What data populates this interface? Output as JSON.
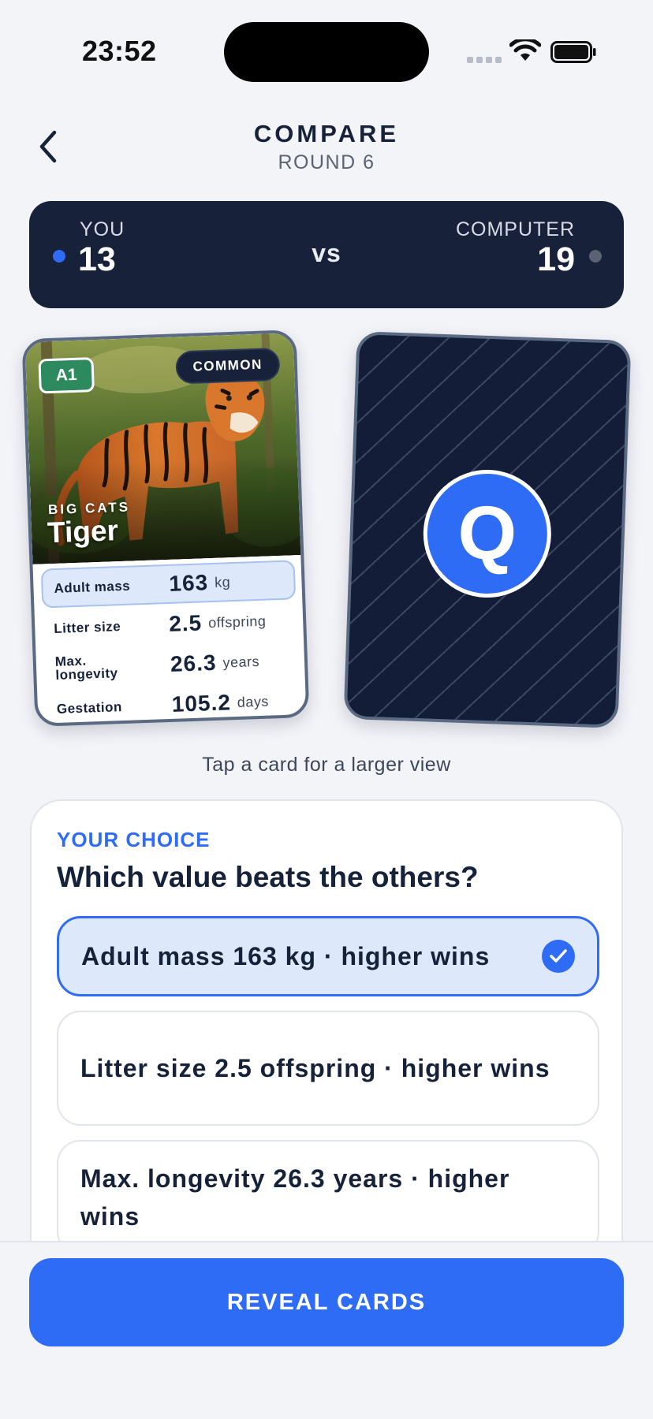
{
  "status_bar": {
    "time": "23:52"
  },
  "header": {
    "title": "COMPARE",
    "subtitle": "ROUND 6"
  },
  "scoreboard": {
    "you_label": "YOU",
    "you_score": "13",
    "vs_label": "vs",
    "computer_label": "COMPUTER",
    "computer_score": "19"
  },
  "player_card": {
    "id_badge": "A1",
    "rarity": "COMMON",
    "category": "BIG CATS",
    "name": "Tiger",
    "stats": [
      {
        "name": "Adult mass",
        "value": "163",
        "unit": "kg"
      },
      {
        "name": "Litter size",
        "value": "2.5",
        "unit": "offspring"
      },
      {
        "name": "Max. longevity",
        "value": "26.3",
        "unit": "years"
      },
      {
        "name": "Gestation",
        "value": "105.2",
        "unit": "days"
      }
    ]
  },
  "computer_card": {
    "face_letter": "Q"
  },
  "hint": "Tap a card for a larger view",
  "choice": {
    "overline": "YOUR CHOICE",
    "question": "Which value beats the others?",
    "options": [
      {
        "label": "Adult mass 163 kg · higher wins",
        "selected": true
      },
      {
        "label": "Litter size 2.5 offspring · higher wins",
        "selected": false
      },
      {
        "label": "Max. longevity 26.3 years · higher wins",
        "selected": false
      }
    ]
  },
  "action": {
    "reveal_label": "REVEAL CARDS"
  },
  "colors": {
    "accent": "#2f6cf5",
    "navy": "#18213a",
    "rarity_green": "#2d8a5f"
  }
}
